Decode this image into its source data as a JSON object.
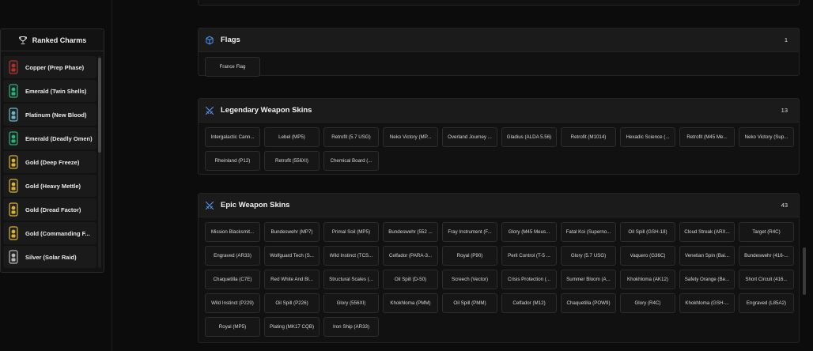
{
  "charms": {
    "title": "Ranked Charms",
    "items": [
      {
        "label": "Copper (Prep Phase)",
        "color": "#b0302a"
      },
      {
        "label": "Emerald (Twin Shells)",
        "color": "#2fb07a"
      },
      {
        "label": "Platinum (New Blood)",
        "color": "#6fb6c4"
      },
      {
        "label": "Emerald (Deadly Omen)",
        "color": "#2fb07a"
      },
      {
        "label": "Gold (Deep Freeze)",
        "color": "#d6b23a"
      },
      {
        "label": "Gold (Heavy Mettle)",
        "color": "#d6b23a"
      },
      {
        "label": "Gold (Dread Factor)",
        "color": "#d6b23a"
      },
      {
        "label": "Gold (Commanding F...",
        "color": "#d6b23a"
      },
      {
        "label": "Silver (Solar Raid)",
        "color": "#b8b8b8"
      }
    ]
  },
  "sections": {
    "flags": {
      "title": "Flags",
      "count": "1",
      "items": [
        "France Flag"
      ]
    },
    "legendary": {
      "title": "Legendary Weapon Skins",
      "count": "13",
      "items": [
        "Intergalactic Cann...",
        "Lebel (MP5)",
        "Retrofit (5.7 USG)",
        "Neko Victory (MP...",
        "Overland Journey ...",
        "Gladius (ALDA 5.56)",
        "Retrofit (M1014)",
        "Hexadic Science (...",
        "Retrofit (M45 Me...",
        "Neko Victory (Sup...",
        "Rheinland (P12)",
        "Retrofit (556XI)",
        "Chemical Board (..."
      ]
    },
    "epic": {
      "title": "Epic Weapon Skins",
      "count": "43",
      "items": [
        "Mission Blacksmit...",
        "Bundeswehr (MP7)",
        "Primal Soil (MP5)",
        "Bundeswehr (552 ...",
        "Fray Instrument (F...",
        "Glory (M45 Meus...",
        "Fatal Koi (Superno...",
        "Oil Spill (GSH-18)",
        "Cloud Streak (ARX...",
        "Target (R4C)",
        "Engraved (AR33)",
        "Wolfguard Tech (S...",
        "Wild Instinct (TCS...",
        "Celfador (PARA-3...",
        "Royal (P90)",
        "Peril Control (T-5 ...",
        "Glory (5.7 USG)",
        "Vaquero (G36C)",
        "Venetian Spin (Bai...",
        "Bundeswehr (416-...",
        "Chaquetilla (C7E)",
        "Red White And Bl...",
        "Structural Scales (...",
        "Oil Spill (D-50)",
        "Screech (Vector)",
        "Crisis Protection (...",
        "Summer Bloom (A...",
        "Khokhloma (AK12)",
        "Safety Orange (Be...",
        "Short Circuit (416...",
        "Wild Instinct (P229)",
        "Oil Spill (P226)",
        "Glory (556XI)",
        "Khokhloma (PMM)",
        "Oil Spill (PMM)",
        "Celfador (M12)",
        "Chaquetilla (POW9)",
        "Glory (R4C)",
        "Khokhloma (GSH-...",
        "Engraved (L85A2)",
        "Royal (MP5)",
        "Plating (MK17 CQB)",
        "Iron Ship (AR33)"
      ]
    }
  },
  "colors": {
    "flag_icon": "#4f8de0",
    "weapon_icon": "#5a8fe6"
  }
}
